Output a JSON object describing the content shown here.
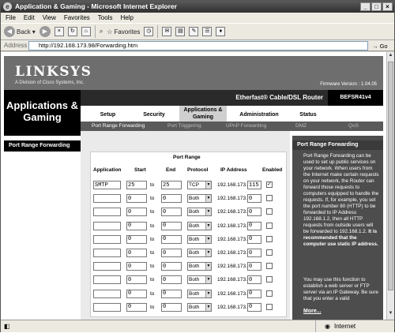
{
  "window": {
    "title": "Application & Gaming - Microsoft Internet Explorer"
  },
  "menu": [
    "File",
    "Edit",
    "View",
    "Favorites",
    "Tools",
    "Help"
  ],
  "toolbar": {
    "back": "Back",
    "favorites": "Favorites"
  },
  "address": {
    "label": "Address",
    "url": "http://192.168.173.98/Forwarding.htm",
    "go": "Go"
  },
  "status": {
    "zone": "Internet"
  },
  "page": {
    "logo": "LINKSYS",
    "logo_sub": "A Division of Cisco Systems, Inc.",
    "firmware": "Firmware Version : 1.04.05",
    "section_title": "Applications & Gaming",
    "product_name": "Etherfast® Cable/DSL Router",
    "product_model": "BEFSR41v4",
    "tabs": [
      "Setup",
      "Security",
      "Applications & Gaming",
      "Administration",
      "Status"
    ],
    "subtabs": [
      "Port Range Forwarding",
      "Port Triggering",
      "UPnP Forwarding",
      "DMZ",
      "QoS"
    ],
    "left_nav": "Port Range Forwarding",
    "form": {
      "group_header": "Port Range",
      "headers": [
        "Application",
        "Start",
        "End",
        "Protocol",
        "IP Address",
        "Enabled"
      ],
      "to_label": "to",
      "ip_prefix": "192.168.173.",
      "rows": [
        {
          "app": "SMTP",
          "start": "25",
          "end": "25",
          "protocol": "TCP",
          "ip": "115",
          "enabled": true
        },
        {
          "app": "",
          "start": "0",
          "end": "0",
          "protocol": "Both",
          "ip": "0",
          "enabled": false
        },
        {
          "app": "",
          "start": "0",
          "end": "0",
          "protocol": "Both",
          "ip": "0",
          "enabled": false
        },
        {
          "app": "",
          "start": "0",
          "end": "0",
          "protocol": "Both",
          "ip": "0",
          "enabled": false
        },
        {
          "app": "",
          "start": "0",
          "end": "0",
          "protocol": "Both",
          "ip": "0",
          "enabled": false
        },
        {
          "app": "",
          "start": "0",
          "end": "0",
          "protocol": "Both",
          "ip": "0",
          "enabled": false
        },
        {
          "app": "",
          "start": "0",
          "end": "0",
          "protocol": "Both",
          "ip": "0",
          "enabled": false
        },
        {
          "app": "",
          "start": "0",
          "end": "0",
          "protocol": "Both",
          "ip": "0",
          "enabled": false
        },
        {
          "app": "",
          "start": "0",
          "end": "0",
          "protocol": "Both",
          "ip": "0",
          "enabled": false
        },
        {
          "app": "",
          "start": "0",
          "end": "0",
          "protocol": "Both",
          "ip": "0",
          "enabled": false
        }
      ]
    },
    "help": {
      "title": "Port Range Forwarding",
      "para1": "Port Range Forwarding can be used to set up public services on your network. When users from the Internet make certain requests on your network, the Router can forward those requests to computers equipped to handle the requests. If, for example, you set the port number 80 (HTTP) to be forwarded to IP Address 192.168.1.2, then all HTTP requests from outside users will be forwarded to 192.168.1.2.",
      "para1_bold": "It is recommended that the computer use static IP address.",
      "para2": "You may use this function to establish a web server or FTP server via an IP Gateway. Be sure that you enter a valid",
      "more": "More..."
    }
  }
}
